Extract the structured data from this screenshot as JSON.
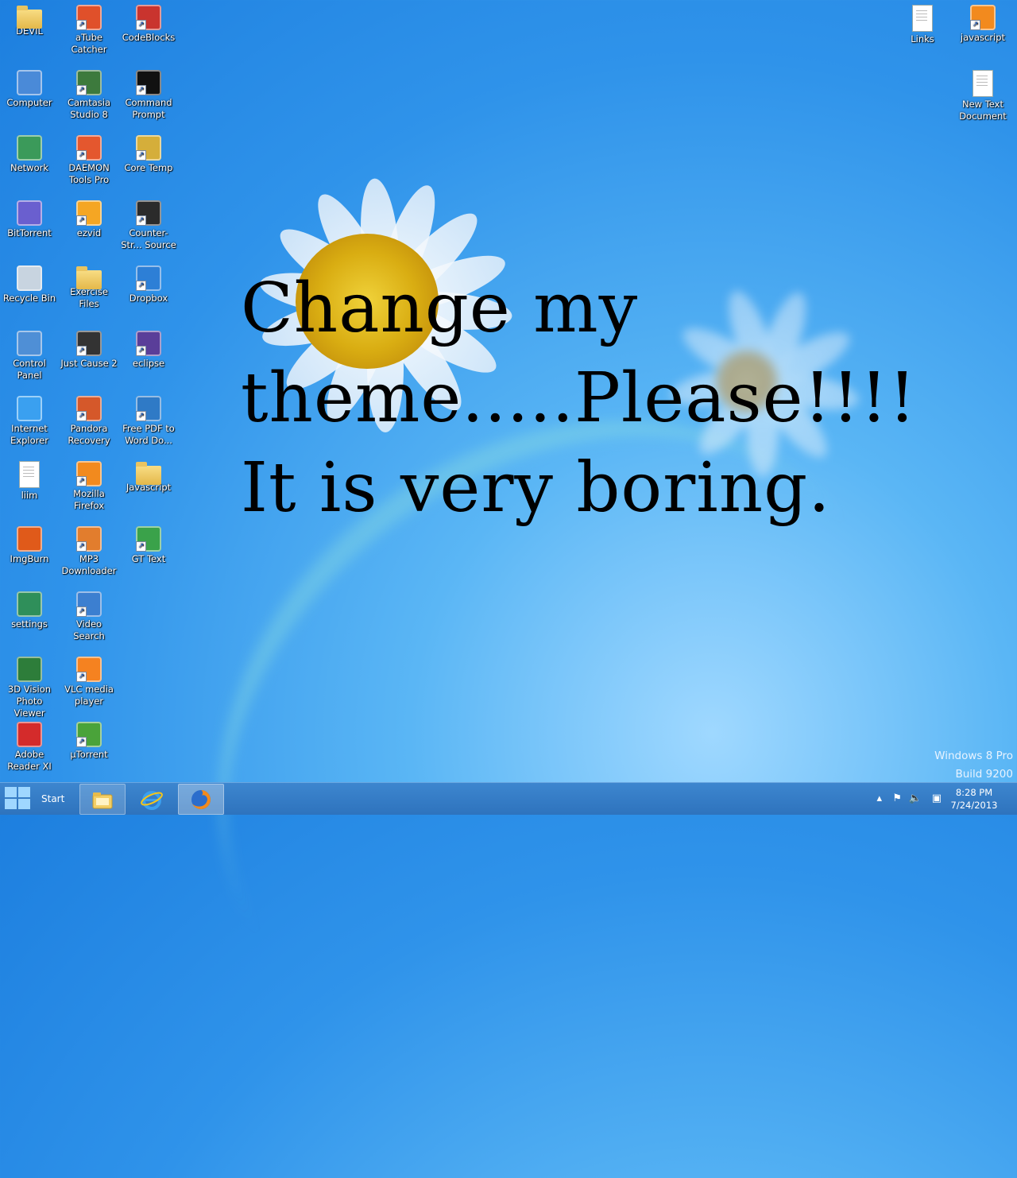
{
  "desktop": {
    "overlay_lines": [
      "Change my",
      "theme.....Please!!!!",
      "It is very boring."
    ],
    "watermark": [
      "Windows 8 Pro",
      "Build 9200"
    ],
    "icons": [
      {
        "label": "DEVIL",
        "icon": "folder-icon",
        "col": 0,
        "row": 0
      },
      {
        "label": "Computer",
        "icon": "computer-icon",
        "col": 0,
        "row": 1
      },
      {
        "label": "Network",
        "icon": "network-icon",
        "col": 0,
        "row": 2
      },
      {
        "label": "BitTorrent",
        "icon": "bittorrent-icon",
        "col": 0,
        "row": 3
      },
      {
        "label": "Recycle Bin",
        "icon": "recycle-bin-icon",
        "col": 0,
        "row": 4
      },
      {
        "label": "Control Panel",
        "icon": "control-panel-icon",
        "col": 0,
        "row": 5
      },
      {
        "label": "Internet Explorer",
        "icon": "internet-explorer-icon",
        "col": 0,
        "row": 6
      },
      {
        "label": "liim",
        "icon": "text-document-icon",
        "col": 0,
        "row": 7
      },
      {
        "label": "ImgBurn",
        "icon": "imgburn-icon",
        "col": 0,
        "row": 8
      },
      {
        "label": "settings",
        "icon": "settings-icon",
        "col": 0,
        "row": 9
      },
      {
        "label": "3D Vision Photo Viewer",
        "icon": "3d-vision-icon",
        "col": 0,
        "row": 10
      },
      {
        "label": "Adobe Reader XI",
        "icon": "adobe-reader-icon",
        "col": 0,
        "row": 11
      },
      {
        "label": "aTube Catcher",
        "icon": "atube-catcher-icon",
        "col": 1,
        "row": 0
      },
      {
        "label": "Camtasia Studio 8",
        "icon": "camtasia-icon",
        "col": 1,
        "row": 1
      },
      {
        "label": "DAEMON Tools Pro",
        "icon": "daemon-tools-icon",
        "col": 1,
        "row": 2
      },
      {
        "label": "ezvid",
        "icon": "ezvid-icon",
        "col": 1,
        "row": 3
      },
      {
        "label": "Exercise Files",
        "icon": "folder-icon",
        "col": 1,
        "row": 4
      },
      {
        "label": "Just Cause 2",
        "icon": "just-cause-icon",
        "col": 1,
        "row": 5
      },
      {
        "label": "Pandora Recovery",
        "icon": "pandora-recovery-icon",
        "col": 1,
        "row": 6
      },
      {
        "label": "Mozilla Firefox",
        "icon": "firefox-icon",
        "col": 1,
        "row": 7
      },
      {
        "label": "MP3 Downloader",
        "icon": "mp3-downloader-icon",
        "col": 1,
        "row": 8
      },
      {
        "label": "Video Search",
        "icon": "video-search-icon",
        "col": 1,
        "row": 9
      },
      {
        "label": "VLC media player",
        "icon": "vlc-icon",
        "col": 1,
        "row": 10
      },
      {
        "label": "µTorrent",
        "icon": "utorrent-icon",
        "col": 1,
        "row": 11
      },
      {
        "label": "CodeBlocks",
        "icon": "codeblocks-icon",
        "col": 2,
        "row": 0
      },
      {
        "label": "Command Prompt",
        "icon": "command-prompt-icon",
        "col": 2,
        "row": 1
      },
      {
        "label": "Core Temp",
        "icon": "core-temp-icon",
        "col": 2,
        "row": 2
      },
      {
        "label": "Counter-Str... Source",
        "icon": "counter-strike-icon",
        "col": 2,
        "row": 3
      },
      {
        "label": "Dropbox",
        "icon": "dropbox-icon",
        "col": 2,
        "row": 4
      },
      {
        "label": "eclipse",
        "icon": "eclipse-icon",
        "col": 2,
        "row": 5
      },
      {
        "label": "Free PDF to Word Do...",
        "icon": "pdf-to-word-icon",
        "col": 2,
        "row": 6
      },
      {
        "label": "Javascript",
        "icon": "folder-icon",
        "col": 2,
        "row": 7
      },
      {
        "label": "GT Text",
        "icon": "gt-text-icon",
        "col": 2,
        "row": 8
      }
    ],
    "right_icons": [
      {
        "label": "Links",
        "icon": "text-document-icon",
        "col": 0,
        "row": 0
      },
      {
        "label": "javascript",
        "icon": "firefox-icon",
        "col": 1,
        "row": 0
      },
      {
        "label": "New Text Document",
        "icon": "text-document-icon",
        "col": 1,
        "row": 1
      }
    ]
  },
  "taskbar": {
    "start_label": "Start",
    "buttons": [
      {
        "name": "file-explorer-taskbar-button",
        "icon": "file-explorer-icon"
      },
      {
        "name": "internet-explorer-taskbar-button",
        "icon": "internet-explorer-icon"
      },
      {
        "name": "firefox-taskbar-button",
        "icon": "firefox-icon"
      }
    ],
    "tray": {
      "time": "8:28 PM",
      "date": "7/24/2013",
      "icons": [
        "chevron-up-icon",
        "action-center-flag-icon",
        "speaker-icon",
        "network-icon"
      ]
    }
  },
  "colors": {
    "taskbar": "#2e73bd",
    "wallpaper": "#2f93ea"
  }
}
